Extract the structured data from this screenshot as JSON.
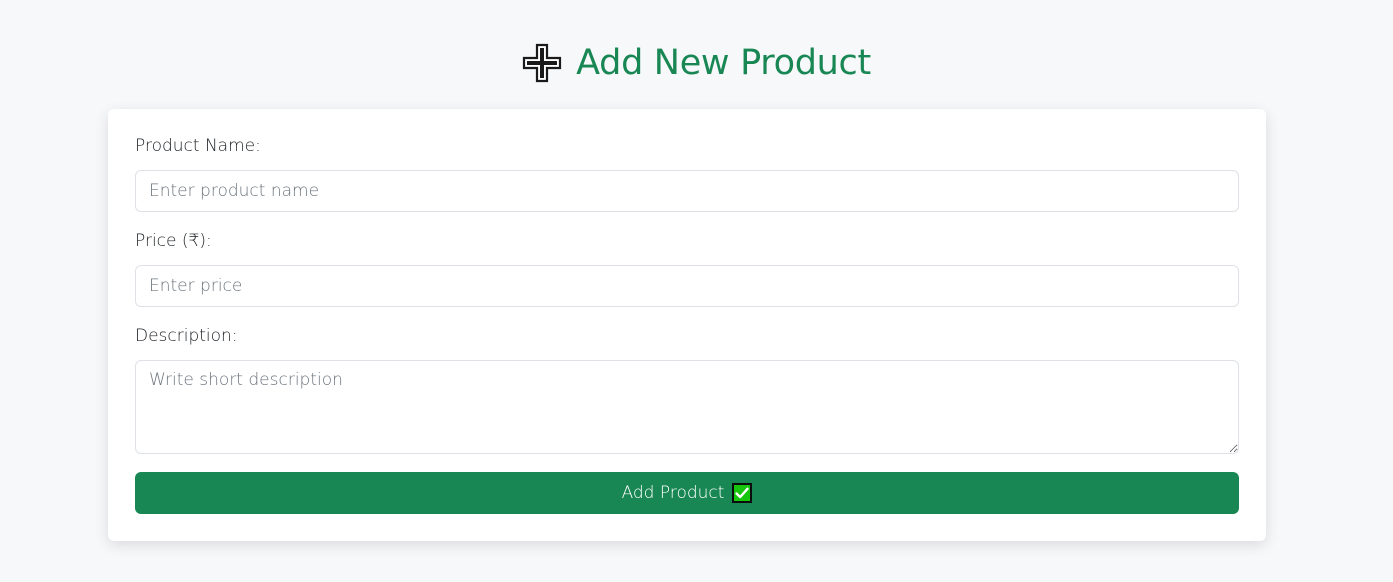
{
  "header": {
    "icon": "plus-icon",
    "title": "Add New Product"
  },
  "form": {
    "product_name": {
      "label": "Product Name:",
      "placeholder": "Enter product name",
      "value": ""
    },
    "price": {
      "label": "Price (₹):",
      "placeholder": "Enter price",
      "value": ""
    },
    "description": {
      "label": "Description:",
      "placeholder": "Write short description",
      "value": ""
    },
    "submit": {
      "label": "Add Product",
      "icon": "check-icon"
    }
  },
  "colors": {
    "accent": "#198754",
    "background": "#f7f8fa",
    "card": "#ffffff",
    "check_box": "#16c60c"
  }
}
